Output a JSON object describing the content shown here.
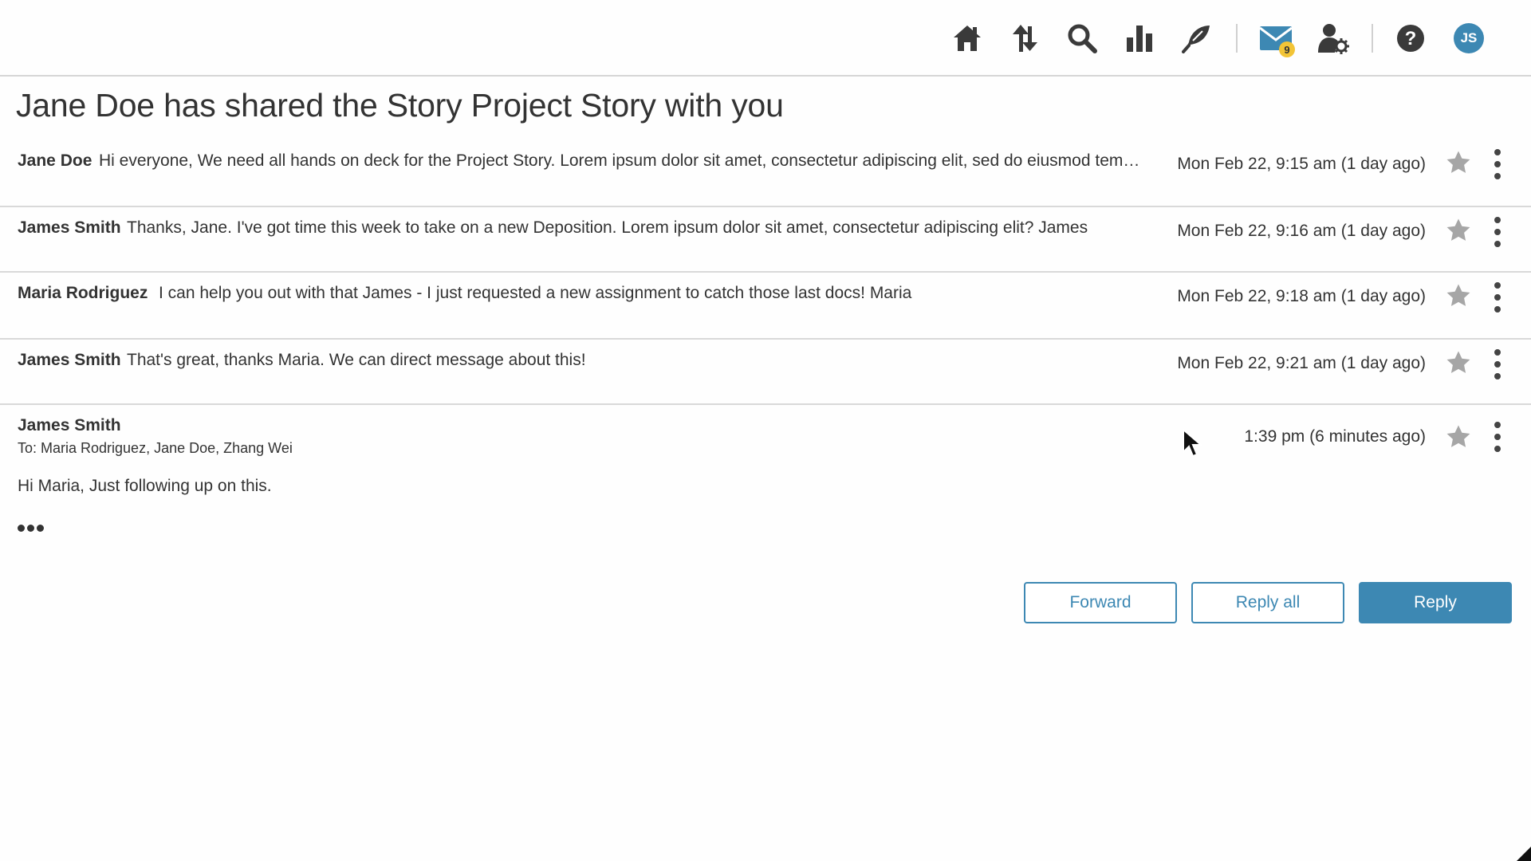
{
  "header": {
    "nav": [
      {
        "name": "home-icon",
        "label": "Home"
      },
      {
        "name": "sort-arrows-icon",
        "label": "Transfers"
      },
      {
        "name": "search-icon",
        "label": "Search"
      },
      {
        "name": "bar-chart-icon",
        "label": "Reports"
      },
      {
        "name": "feather-pen-icon",
        "label": "Stories"
      },
      {
        "name": "mail-icon",
        "label": "Messages",
        "badge": "9"
      },
      {
        "name": "user-settings-icon",
        "label": "Account settings"
      },
      {
        "name": "help-icon",
        "label": "Help"
      }
    ],
    "avatar_initials": "JS",
    "accent_color": "#3d88b3",
    "badge_color": "#f2c436"
  },
  "page": {
    "title": "Jane Doe has shared the Story Project Story with you"
  },
  "messages": [
    {
      "sender": "Jane Doe",
      "preview": "Hi everyone,  We need all hands on deck for the Project Story. Lorem ipsum dolor sit amet, consectetur adipiscing elit, sed do eiusmod tempor incididunt",
      "time": "Mon Feb 22, 9:15 am (1 day ago)",
      "starred": false
    },
    {
      "sender": "James Smith",
      "preview": "Thanks, Jane. I've got time this week to take on a new Deposition. Lorem ipsum dolor sit amet, consectetur adipiscing elit? James",
      "time": "Mon Feb 22, 9:16 am (1 day ago)",
      "starred": false
    },
    {
      "sender": "Maria Rodriguez",
      "preview": "I can help you out with that James - I just requested a new assignment to catch those last docs! Maria",
      "time": "Mon Feb 22, 9:18 am (1 day ago)",
      "starred": false
    },
    {
      "sender": "James Smith",
      "preview": "That's great, thanks Maria. We can direct message about this!",
      "time": "Mon Feb 22, 9:21 am (1 day ago)",
      "starred": false
    }
  ],
  "expanded": {
    "sender": "James Smith",
    "to": "To: Maria Rodriguez, Jane Doe, Zhang Wei",
    "time": "1:39 pm (6 minutes ago)",
    "body": "Hi Maria, Just following up on this.",
    "starred": false
  },
  "actions": {
    "forward": "Forward",
    "reply_all": "Reply all",
    "reply": "Reply"
  }
}
